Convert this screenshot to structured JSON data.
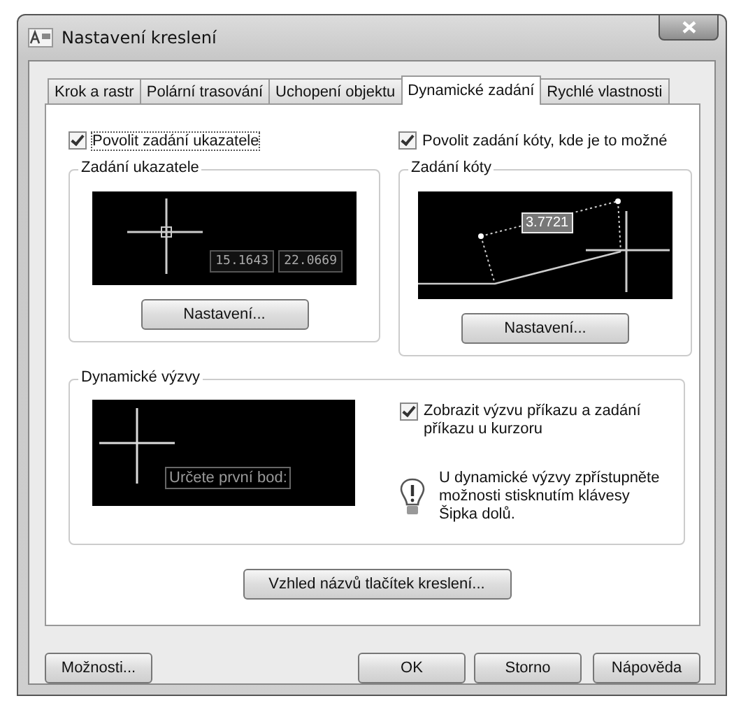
{
  "window": {
    "title": "Nastavení kreslení"
  },
  "tabs": [
    {
      "label": "Krok a rastr",
      "selected": false
    },
    {
      "label": "Polární trasování",
      "selected": false
    },
    {
      "label": "Uchopení objektu",
      "selected": false
    },
    {
      "label": "Dynamické zadání",
      "selected": true
    },
    {
      "label": "Rychlé vlastnosti",
      "selected": false
    }
  ],
  "pointer_input": {
    "enable": {
      "label": "Povolit zadání ukazatele",
      "checked": true
    },
    "group_title": "Zadání ukazatele",
    "preview_values": [
      "15.1643",
      "22.0669"
    ],
    "button": "Nastavení..."
  },
  "dimension_input": {
    "enable": {
      "label": "Povolit zadání kóty, kde je to možné",
      "checked": true
    },
    "group_title": "Zadání kóty",
    "preview_value": "3.7721",
    "button": "Nastavení..."
  },
  "dynamic_prompts": {
    "group_title": "Dynamické výzvy",
    "preview_prompt": "Určete první bod:",
    "show": {
      "label": "Zobrazit výzvu příkazu a zadání příkazu u kurzoru",
      "checked": true
    },
    "tip": "U dynamické výzvy zpřístupněte možnosti stisknutím klávesy Šipka dolů."
  },
  "appearance_button": "Vzhled názvů tlačítek kreslení...",
  "buttons": [
    "Možnosti...",
    "OK",
    "Storno",
    "Nápověda"
  ]
}
